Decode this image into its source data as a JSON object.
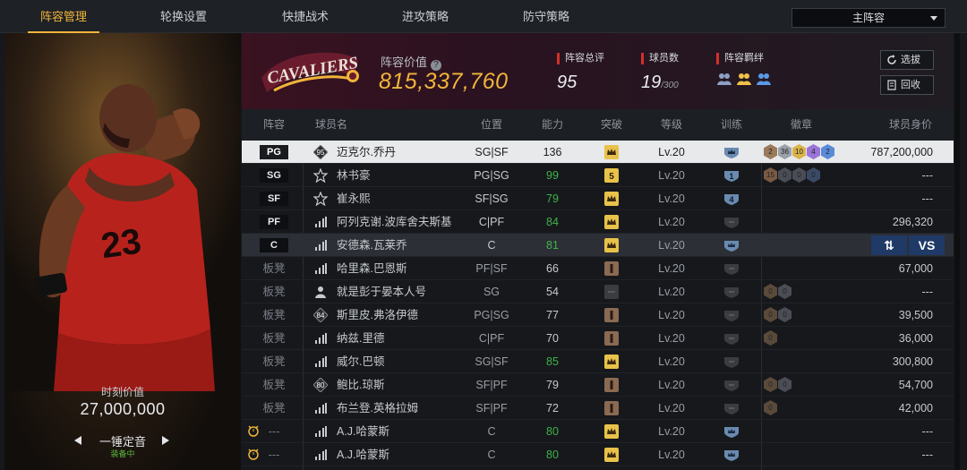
{
  "tabs": [
    {
      "label": "阵容管理",
      "active": true
    },
    {
      "label": "轮换设置",
      "active": false
    },
    {
      "label": "快捷战术",
      "active": false
    },
    {
      "label": "进攻策略",
      "active": false
    },
    {
      "label": "防守策略",
      "active": false
    }
  ],
  "lineup_select": {
    "value": "主阵容"
  },
  "left_panel": {
    "moment_label": "时刻价值",
    "moment_value": "27,000,000",
    "skill_name": "一锤定音",
    "skill_status": "装备中"
  },
  "header": {
    "logo_text": "CAVALIERS",
    "value_label": "阵容价值",
    "value": "815,337,760",
    "stats": [
      {
        "label": "阵容总评",
        "value": "95",
        "suffix": ""
      },
      {
        "label": "球员数",
        "value": "19",
        "suffix": "/300"
      },
      {
        "label": "阵容羁绊",
        "value": "",
        "suffix": ""
      }
    ],
    "buttons": {
      "select": "选拔",
      "recycle": "回收"
    }
  },
  "columns": [
    "阵容",
    "球员名",
    "位置",
    "能力",
    "突破",
    "等级",
    "训练",
    "徽章",
    "球员身价"
  ],
  "rows": [
    {
      "slot": "PG",
      "bench": false,
      "icon": "95",
      "name": "迈克尔.乔丹",
      "pos": "SG|SF",
      "ability": "136",
      "ability_green": false,
      "breakthrough": "crown-gold",
      "level": "Lv.20",
      "training": "crown",
      "badges": [
        {
          "t": "2",
          "c": "#9a7a5a"
        },
        {
          "t": "36",
          "c": "#9aa0a8"
        },
        {
          "t": "10",
          "c": "#d8b44a"
        },
        {
          "t": "4",
          "c": "#9a74d8"
        },
        {
          "t": "2",
          "c": "#5a8ad8"
        }
      ],
      "price": "787,200,000",
      "state": "selected"
    },
    {
      "slot": "SG",
      "bench": false,
      "icon": "star",
      "name": "林书豪",
      "pos": "PG|SG",
      "ability": "99",
      "ability_green": true,
      "breakthrough": "5",
      "level": "Lv.20",
      "training": "1",
      "badges": [
        {
          "t": "15",
          "c": "#7a5a44"
        },
        {
          "t": "0",
          "c": "#4a4d55"
        },
        {
          "t": "0",
          "c": "#4a4d55"
        },
        {
          "t": "0",
          "c": "#3a4a66"
        }
      ],
      "price": "---",
      "state": ""
    },
    {
      "slot": "SF",
      "bench": false,
      "icon": "star",
      "name": "崔永熙",
      "pos": "SF|SG",
      "ability": "79",
      "ability_green": true,
      "breakthrough": "crown-gold",
      "level": "Lv.20",
      "training": "4",
      "badges": [],
      "price": "---",
      "state": ""
    },
    {
      "slot": "PF",
      "bench": false,
      "icon": "bars",
      "name": "阿列克谢.波库舍夫斯基",
      "pos": "C|PF",
      "ability": "84",
      "ability_green": true,
      "breakthrough": "crown-gold",
      "level": "Lv.20",
      "training": "empty",
      "badges": [],
      "price": "296,320",
      "state": ""
    },
    {
      "slot": "C",
      "bench": false,
      "icon": "bars",
      "name": "安德森.瓦莱乔",
      "pos": "C",
      "ability": "81",
      "ability_green": true,
      "breakthrough": "crown-gold",
      "level": "Lv.20",
      "training": "crown",
      "badges": [],
      "price": "",
      "state": "hover"
    },
    {
      "slot": "板凳",
      "bench": true,
      "icon": "bars",
      "name": "哈里森.巴恩斯",
      "pos": "PF|SF",
      "ability": "66",
      "ability_green": false,
      "breakthrough": "1",
      "level": "Lv.20",
      "training": "empty",
      "badges": [],
      "price": "67,000",
      "state": ""
    },
    {
      "slot": "板凳",
      "bench": true,
      "icon": "person",
      "name": "就是彭于晏本人号",
      "pos": "SG",
      "ability": "54",
      "ability_green": false,
      "breakthrough": "empty",
      "level": "Lv.20",
      "training": "empty",
      "badges": [
        {
          "t": "0",
          "c": "#5a4a3a"
        },
        {
          "t": "0",
          "c": "#4a4d55"
        }
      ],
      "price": "---",
      "state": ""
    },
    {
      "slot": "板凳",
      "bench": true,
      "icon": "84",
      "name": "斯里皮.弗洛伊德",
      "pos": "PG|SG",
      "ability": "77",
      "ability_green": false,
      "breakthrough": "1",
      "level": "Lv.20",
      "training": "empty",
      "badges": [
        {
          "t": "0",
          "c": "#5a4a3a"
        },
        {
          "t": "0",
          "c": "#4a4d55"
        }
      ],
      "price": "39,500",
      "state": ""
    },
    {
      "slot": "板凳",
      "bench": true,
      "icon": "bars",
      "name": "纳兹.里德",
      "pos": "C|PF",
      "ability": "70",
      "ability_green": false,
      "breakthrough": "1",
      "level": "Lv.20",
      "training": "empty",
      "badges": [
        {
          "t": "0",
          "c": "#5a4a3a"
        }
      ],
      "price": "36,000",
      "state": ""
    },
    {
      "slot": "板凳",
      "bench": true,
      "icon": "bars",
      "name": "威尔.巴顿",
      "pos": "SG|SF",
      "ability": "85",
      "ability_green": true,
      "breakthrough": "crown-gold",
      "level": "Lv.20",
      "training": "empty",
      "badges": [],
      "price": "300,800",
      "state": ""
    },
    {
      "slot": "板凳",
      "bench": true,
      "icon": "80",
      "name": "鲍比.琼斯",
      "pos": "SF|PF",
      "ability": "79",
      "ability_green": false,
      "breakthrough": "1",
      "level": "Lv.20",
      "training": "empty",
      "badges": [
        {
          "t": "0",
          "c": "#5a4a3a"
        },
        {
          "t": "0",
          "c": "#4a4d55"
        }
      ],
      "price": "54,700",
      "state": ""
    },
    {
      "slot": "板凳",
      "bench": true,
      "icon": "bars",
      "name": "布兰登.英格拉姆",
      "pos": "SF|PF",
      "ability": "72",
      "ability_green": false,
      "breakthrough": "1",
      "level": "Lv.20",
      "training": "empty",
      "badges": [
        {
          "t": "0",
          "c": "#5a4a3a"
        }
      ],
      "price": "42,000",
      "state": ""
    },
    {
      "slot": "---",
      "bench": true,
      "alarm": true,
      "icon": "bars",
      "name": "A.J.哈蒙斯",
      "pos": "C",
      "ability": "80",
      "ability_green": true,
      "breakthrough": "crown-gold",
      "level": "Lv.20",
      "training": "crown",
      "badges": [],
      "price": "---",
      "state": ""
    },
    {
      "slot": "---",
      "bench": true,
      "alarm": true,
      "icon": "bars",
      "name": "A.J.哈蒙斯",
      "pos": "C",
      "ability": "80",
      "ability_green": true,
      "breakthrough": "crown-gold",
      "level": "Lv.20",
      "training": "crown",
      "badges": [],
      "price": "---",
      "state": ""
    }
  ],
  "hover_actions": {
    "swap": "⇅",
    "vs": "VS"
  }
}
